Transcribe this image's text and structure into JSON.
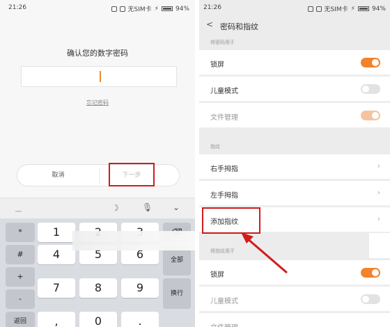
{
  "left": {
    "status": {
      "time": "21:26",
      "carrier": "无SIM卡",
      "battery": "94%"
    },
    "pin": {
      "title": "确认您的数字密码",
      "forgot": "忘记密码"
    },
    "buttons": {
      "cancel": "取消",
      "next": "下一步"
    },
    "keyboard": {
      "toolbar_dash": "__",
      "side_left": [
        "*",
        "#",
        "+",
        "-",
        "返回"
      ],
      "digits": [
        "1",
        "2",
        "3",
        "4",
        "5",
        "6",
        "7",
        "8",
        "9",
        ",",
        "0",
        "."
      ],
      "side_right": [
        "⌫",
        "",
        "全部",
        "换行"
      ]
    }
  },
  "right": {
    "status": {
      "time": "21:26",
      "carrier": "无SIM卡",
      "battery": "94%"
    },
    "header": {
      "title": "密码和指纹"
    },
    "section_password": "将密码用于",
    "password_rows": [
      {
        "label": "锁屏",
        "toggle": "on"
      },
      {
        "label": "儿童模式",
        "toggle": "off"
      },
      {
        "label": "文件管理",
        "toggle": "dim"
      }
    ],
    "section_fingerprint": "指纹",
    "fingerprint_rows": [
      {
        "label": "右手拇指"
      },
      {
        "label": "左手拇指"
      },
      {
        "label": "添加指纹"
      }
    ],
    "section_fingerprint_use": "将指纹用于",
    "fingerprint_use_rows": [
      {
        "label": "锁屏",
        "toggle": "on"
      },
      {
        "label": "儿童模式",
        "toggle": "off"
      },
      {
        "label": "文件管理"
      }
    ]
  },
  "colors": {
    "accent": "#f2822b",
    "highlight": "#d21b1b"
  }
}
